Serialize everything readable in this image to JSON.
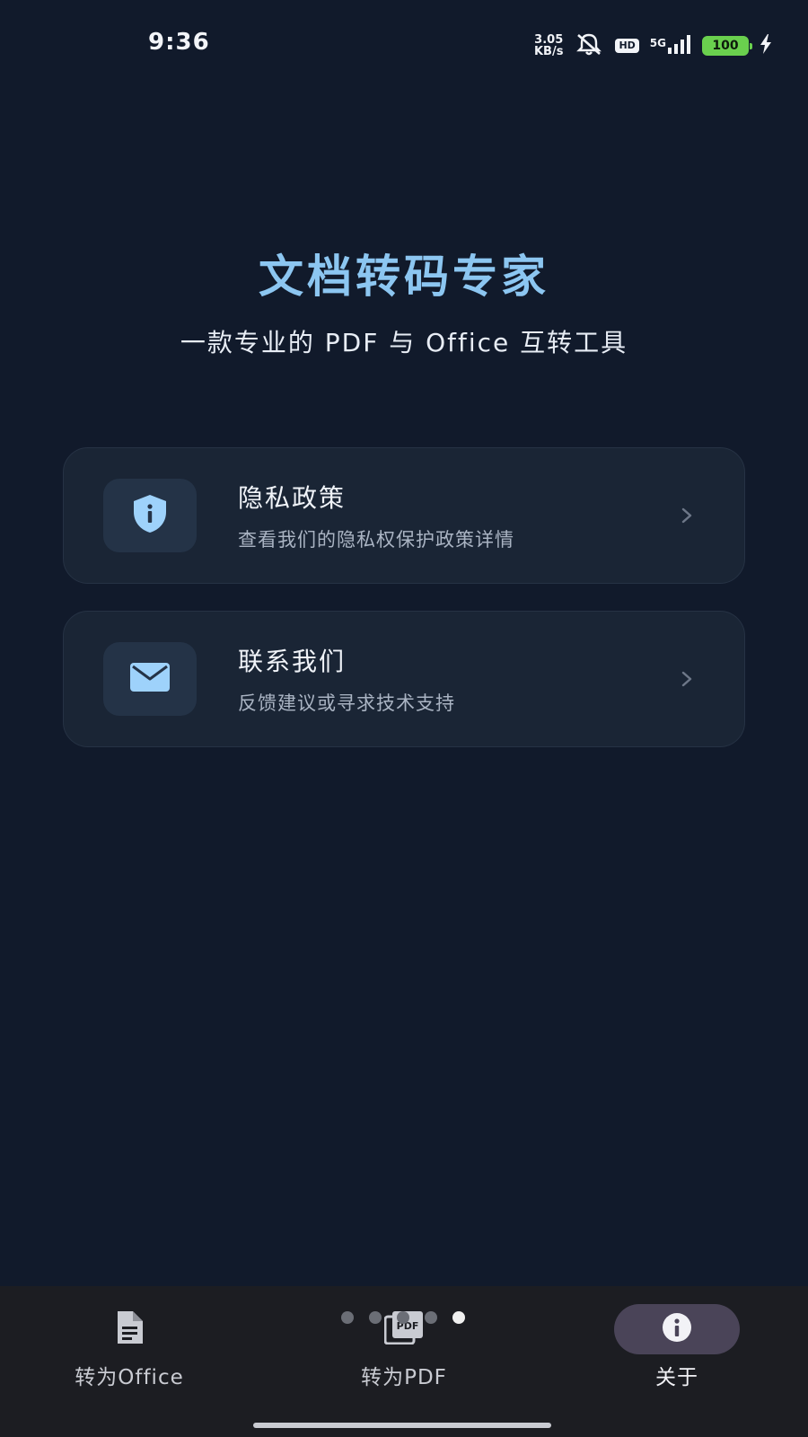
{
  "status_bar": {
    "time": "9:36",
    "net_speed_value": "3.05",
    "net_speed_unit": "KB/s",
    "hd_label": "HD",
    "network_label": "5G",
    "battery_level": "100",
    "icons": [
      "mute-bell-icon",
      "signal-icon",
      "battery-icon",
      "charging-icon"
    ]
  },
  "header": {
    "title": "文档转码专家",
    "subtitle": "一款专业的 PDF 与 Office 互转工具"
  },
  "menu": [
    {
      "title": "隐私政策",
      "description": "查看我们的隐私权保护政策详情",
      "icon": "shield-info-icon"
    },
    {
      "title": "联系我们",
      "description": "反馈建议或寻求技术支持",
      "icon": "mail-icon"
    }
  ],
  "bottom_nav": {
    "items": [
      {
        "label": "转为Office",
        "icon": "document-icon",
        "selected": false
      },
      {
        "label": "转为PDF",
        "icon": "pdf-icon",
        "selected": false
      },
      {
        "label": "关于",
        "icon": "info-icon",
        "selected": true
      }
    ],
    "page_dots": 5,
    "active_dot": 5
  },
  "colors": {
    "background": "#111a2b",
    "title_accent": "#8cc6f1",
    "card_background": "#1a2535",
    "icon_accent": "#9ed2fb",
    "nav_selected_pill": "#4a4458",
    "battery": "#6ad04e"
  }
}
